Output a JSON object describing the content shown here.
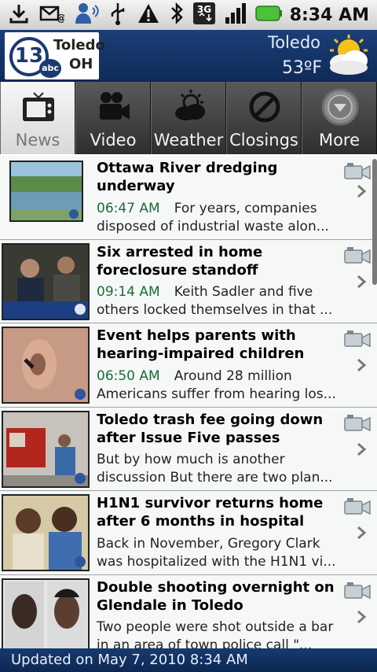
{
  "status_bar": {
    "icons": [
      "download-icon",
      "sms-email-icon",
      "contacts-icon",
      "usb-icon",
      "warning-icon",
      "bluetooth-icon",
      "3g-icon",
      "signal-icon",
      "battery-icon"
    ],
    "network": "3G",
    "time": "8:34 AM"
  },
  "header": {
    "logo_number": "13",
    "logo_network": "abc",
    "logo_city": "Toledo",
    "logo_state": "OH",
    "city": "Toledo",
    "temperature": "53ºF",
    "weather_icon": "partly-cloudy-icon"
  },
  "tabs": [
    {
      "label": "News",
      "icon": "tv-icon",
      "active": true
    },
    {
      "label": "Video",
      "icon": "video-camera-icon",
      "active": false
    },
    {
      "label": "Weather",
      "icon": "weather-cloud-icon",
      "active": false
    },
    {
      "label": "Closings",
      "icon": "closed-icon",
      "active": false
    },
    {
      "label": "More",
      "icon": "more-chevron-icon",
      "active": false
    }
  ],
  "stories": [
    {
      "headline": "Ottawa River dredging underway",
      "time": "06:47 AM",
      "summary": "For years, companies disposed of industrial waste alon..."
    },
    {
      "headline": "Six arrested in home foreclosure standoff",
      "time": "09:14 AM",
      "summary": "Keith Sadler and five others locked themselves in that ..."
    },
    {
      "headline": "Event helps parents with hearing-impaired children",
      "time": "06:50 AM",
      "summary": "Around 28 million Americans suffer from hearing los..."
    },
    {
      "headline": "Toledo trash fee going down after Issue Five passes",
      "time": "",
      "summary": "But by how much is another discussion But there are two plan..."
    },
    {
      "headline": "H1N1 survivor returns home after 6 months in hospital",
      "time": "",
      "summary": "Back in November, Gregory Clark was hospitalized with the H1N1 vi..."
    },
    {
      "headline": "Double shooting overnight on Glendale in Toledo",
      "time": "",
      "summary": "Two people were shot outside a bar in an area of town police call \"..."
    }
  ],
  "footer": {
    "updated": "Updated on May 7, 2010 8:34 AM"
  },
  "colors": {
    "header_blue": "#1b3f78",
    "time_green": "#1a6b3a",
    "tab_dark": "#2e2e2e"
  }
}
